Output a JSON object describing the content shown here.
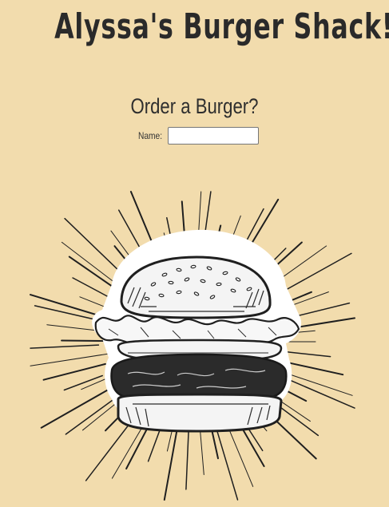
{
  "header": {
    "title": "Alyssa's Burger Shack!"
  },
  "order": {
    "heading": "Order a Burger?",
    "name_label": "Name:",
    "name_value": ""
  },
  "illustration": {
    "icon": "burger-sketch-icon"
  },
  "colors": {
    "background": "#f2dcad",
    "text": "#2a2a2a"
  }
}
